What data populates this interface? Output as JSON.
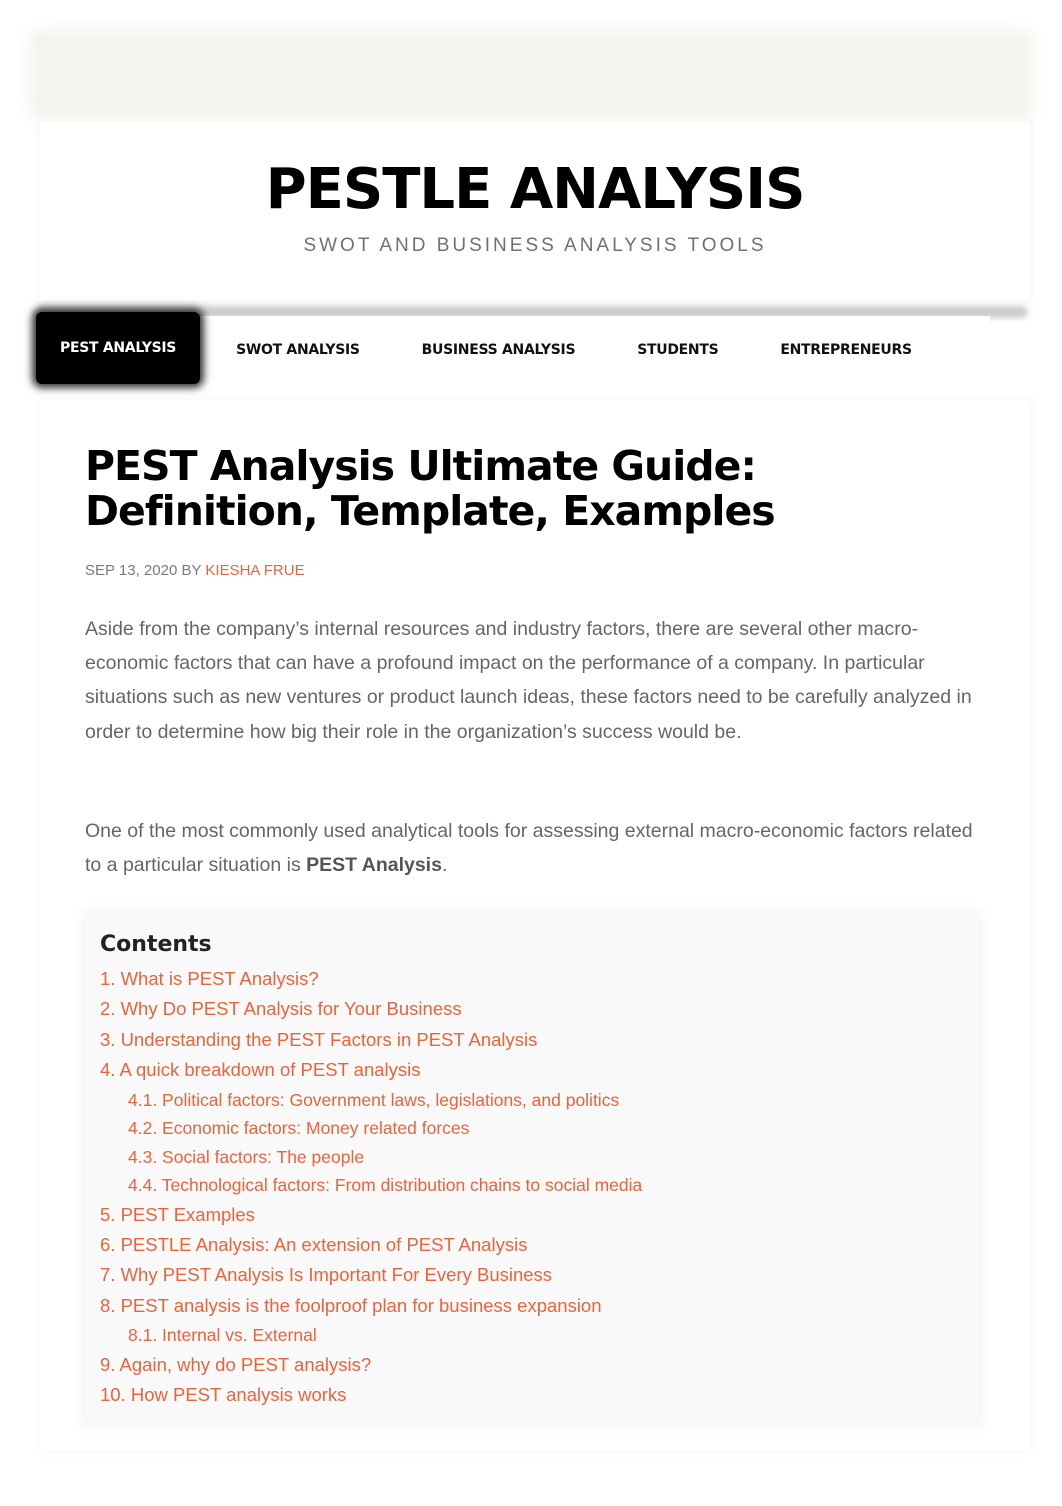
{
  "site": {
    "title": "PESTLE ANALYSIS",
    "tagline": "SWOT AND BUSINESS ANALYSIS TOOLS"
  },
  "nav": {
    "items": [
      {
        "label": "PEST ANALYSIS",
        "active": true
      },
      {
        "label": "SWOT ANALYSIS",
        "active": false
      },
      {
        "label": "BUSINESS ANALYSIS",
        "active": false
      },
      {
        "label": "STUDENTS",
        "active": false
      },
      {
        "label": "ENTREPRENEURS",
        "active": false
      }
    ]
  },
  "article": {
    "title": "PEST Analysis Ultimate Guide: Definition, Template, Examples",
    "meta": {
      "date": "SEP 13, 2020",
      "by": "BY",
      "author": "KIESHA FRUE"
    },
    "paragraphs": [
      "Aside from the company’s internal resources and industry factors, there are several other macro-economic factors that can have a profound impact on the performance of a company. In particular situations such as new ventures or product launch ideas, these factors need to be carefully analyzed in order to determine how big their role in the organization’s success would be.",
      {
        "before": "One of the most commonly used analytical tools for assessing external macro-economic factors related to a particular situation is ",
        "bold": "PEST Analysis",
        "after": "."
      }
    ]
  },
  "toc": {
    "title": "Contents",
    "items": [
      {
        "label": "1. What is PEST Analysis?",
        "level": 1
      },
      {
        "label": "2. Why Do PEST Analysis for Your Business",
        "level": 1
      },
      {
        "label": "3. Understanding the PEST Factors in PEST Analysis",
        "level": 1
      },
      {
        "label": "4. A quick breakdown of PEST analysis",
        "level": 1
      },
      {
        "label": "4.1. Political factors: Government laws, legislations, and politics",
        "level": 2
      },
      {
        "label": "4.2. Economic factors: Money related forces",
        "level": 2
      },
      {
        "label": "4.3. Social factors: The people",
        "level": 2
      },
      {
        "label": "4.4. Technological factors: From distribution chains to social media",
        "level": 2
      },
      {
        "label": "5. PEST Examples",
        "level": 1
      },
      {
        "label": "6. PESTLE Analysis: An extension of PEST Analysis",
        "level": 1
      },
      {
        "label": "7. Why PEST Analysis Is Important For Every Business",
        "level": 1
      },
      {
        "label": "8. PEST analysis is the foolproof plan for business expansion",
        "level": 1
      },
      {
        "label": "8.1. Internal vs. External",
        "level": 2
      },
      {
        "label": "9. Again, why do PEST analysis?",
        "level": 1
      },
      {
        "label": "10. How PEST analysis works",
        "level": 1
      }
    ]
  },
  "colors": {
    "accent": "#e8643b",
    "nav_active_bg": "#000000",
    "body_text": "#666666",
    "toc_bg": "#f9f9f9"
  }
}
